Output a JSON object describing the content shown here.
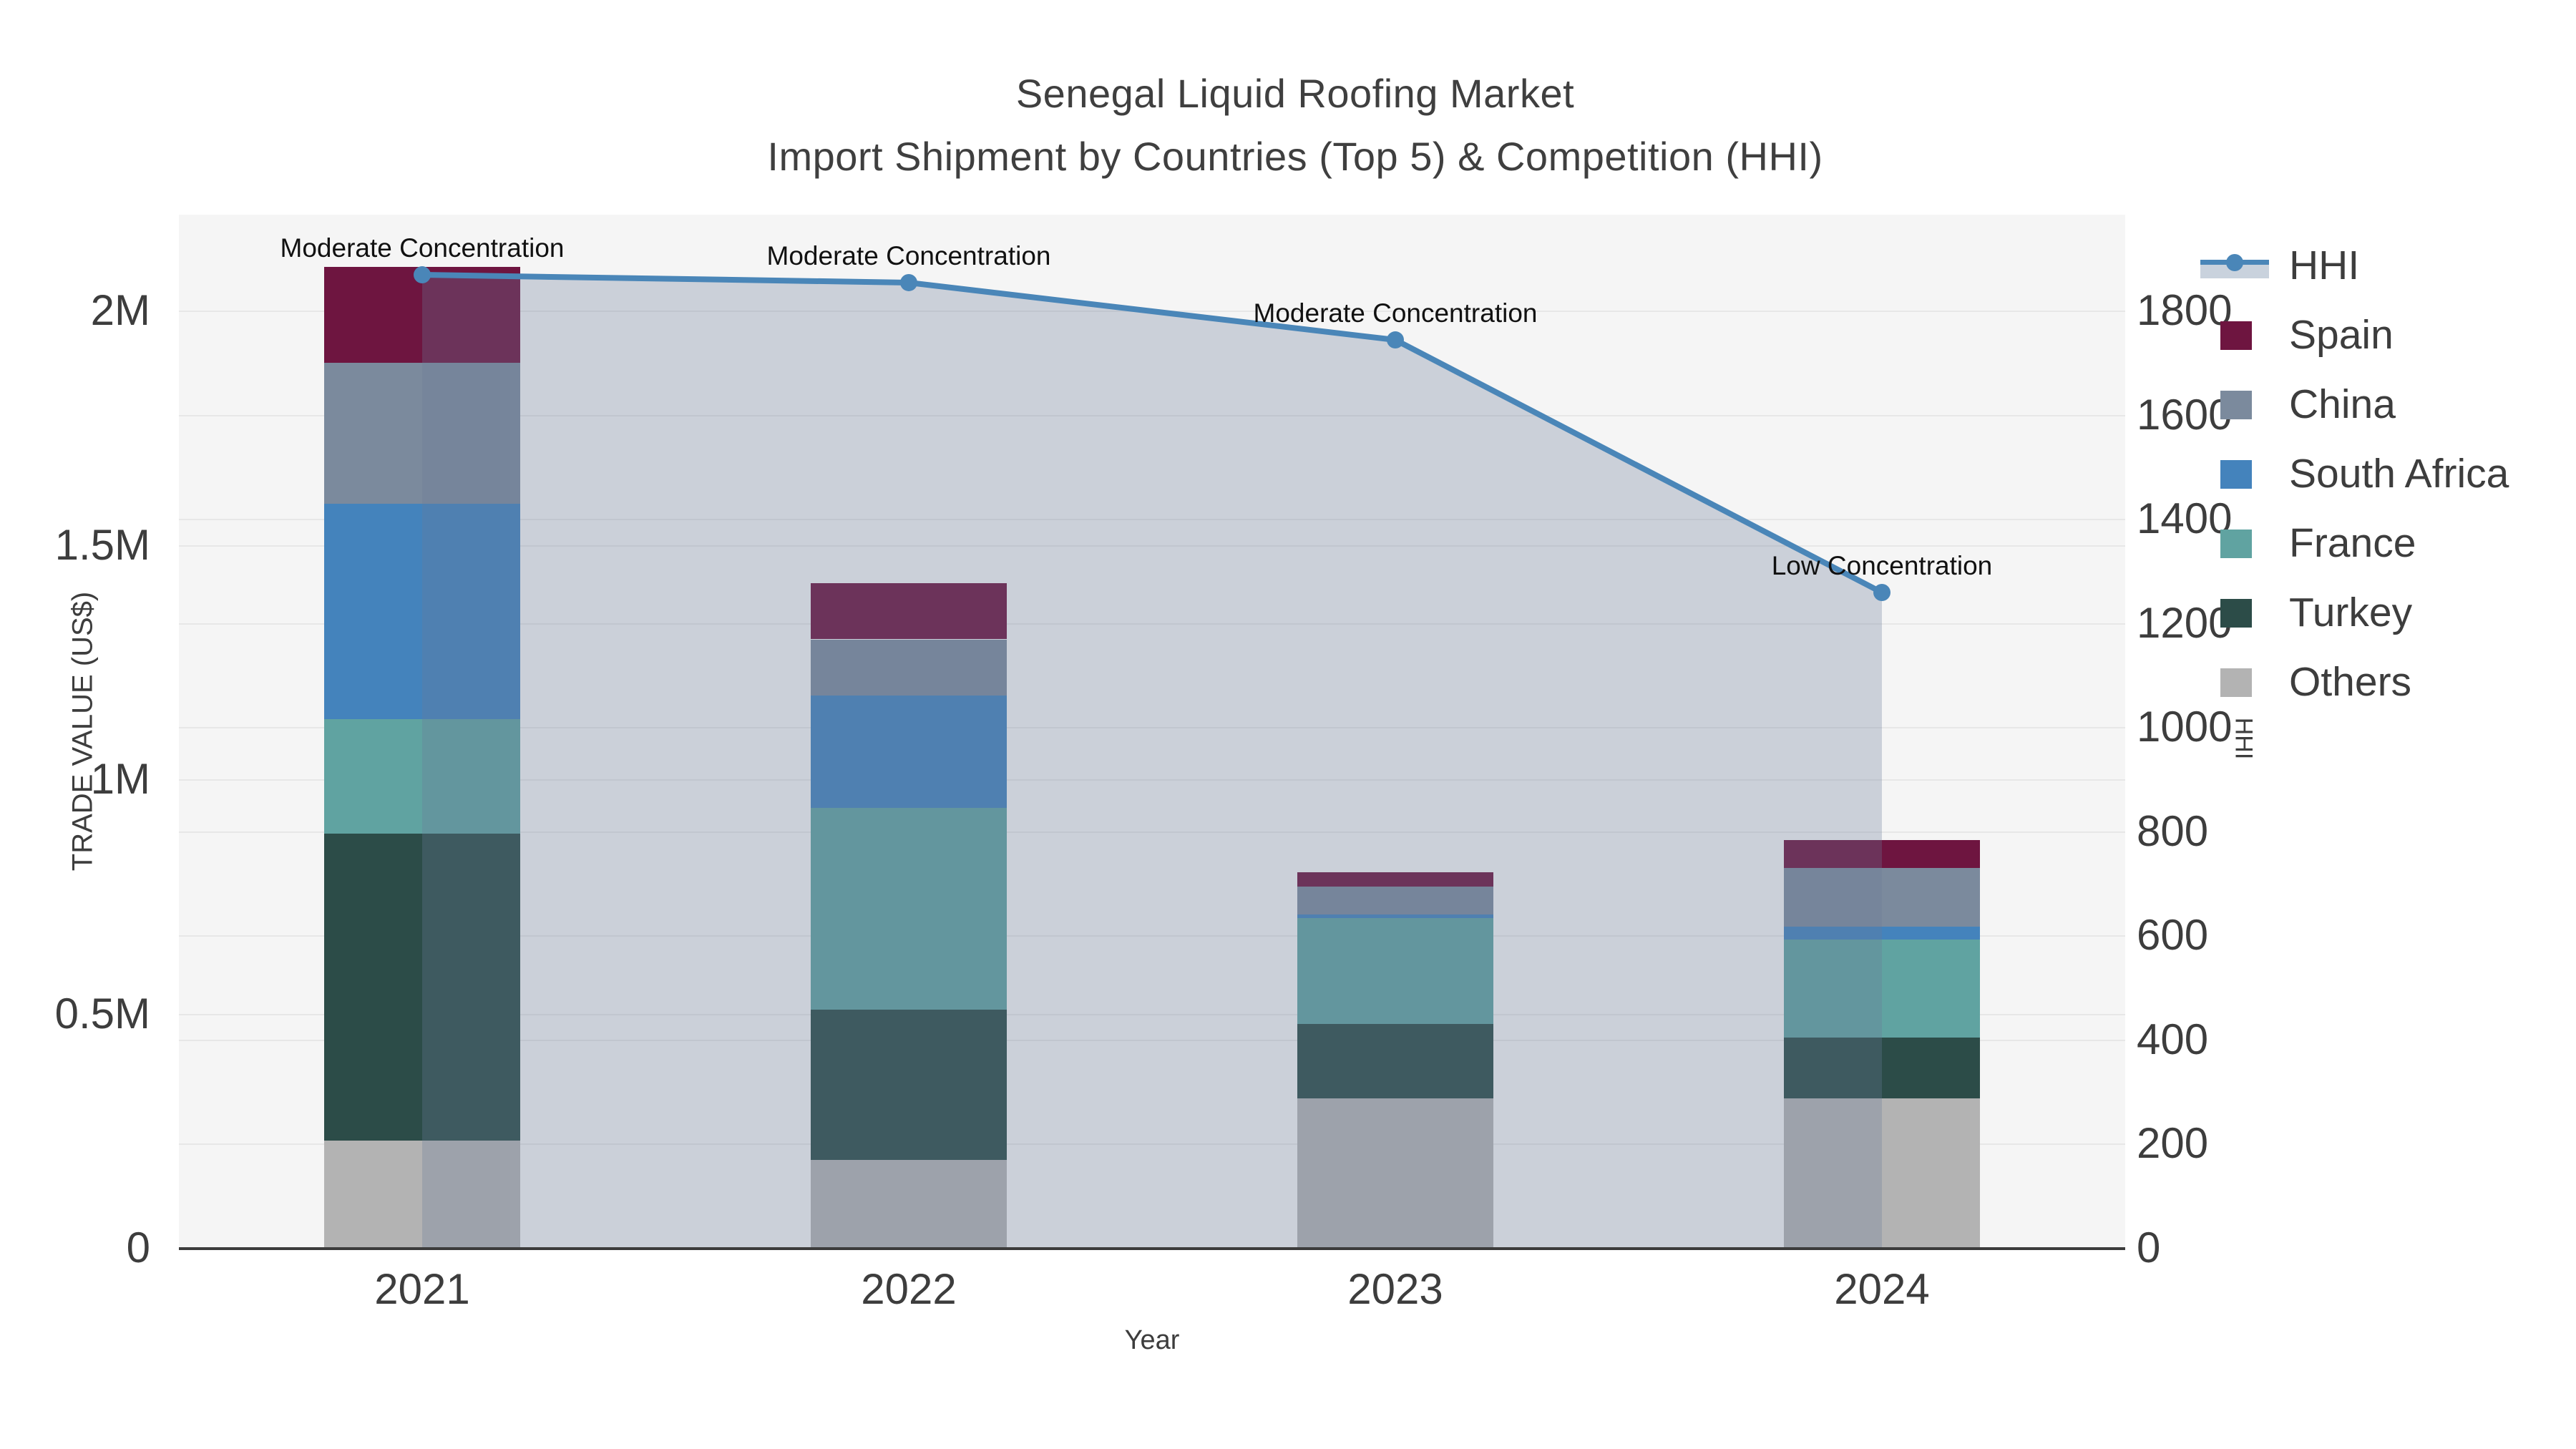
{
  "title": {
    "line1": "Senegal Liquid Roofing Market",
    "line2": "Import Shipment by Countries (Top 5) & Competition (HHI)"
  },
  "axes": {
    "x": {
      "title": "Year",
      "categories": [
        "2021",
        "2022",
        "2023",
        "2024"
      ]
    },
    "y_left": {
      "title": "TRADE VALUE (US$)",
      "ticks": [
        {
          "value": 0,
          "label": "0"
        },
        {
          "value": 500000,
          "label": "0.5M"
        },
        {
          "value": 1000000,
          "label": "1M"
        },
        {
          "value": 1500000,
          "label": "1.5M"
        },
        {
          "value": 2000000,
          "label": "2M"
        }
      ],
      "max_tick_value": 2000000
    },
    "y_right": {
      "title": "HHI",
      "ticks": [
        0,
        200,
        400,
        600,
        800,
        1000,
        1200,
        1400,
        1600,
        1800
      ],
      "max_tick_value": 1800
    }
  },
  "legend": [
    {
      "label": "HHI",
      "type": "line",
      "color": "#4a86b8"
    },
    {
      "label": "Spain",
      "type": "swatch",
      "color": "#6e1540"
    },
    {
      "label": "China",
      "type": "swatch",
      "color": "#7b8a9d"
    },
    {
      "label": "South Africa",
      "type": "swatch",
      "color": "#4483bc"
    },
    {
      "label": "France",
      "type": "swatch",
      "color": "#60a3a1"
    },
    {
      "label": "Turkey",
      "type": "swatch",
      "color": "#2c4c48"
    },
    {
      "label": "Others",
      "type": "swatch",
      "color": "#b3b3b3"
    }
  ],
  "annotations": [
    {
      "category": "2021",
      "text": "Moderate Concentration"
    },
    {
      "category": "2022",
      "text": "Moderate Concentration"
    },
    {
      "category": "2023",
      "text": "Moderate Concentration"
    },
    {
      "category": "2024",
      "text": "Low Concentration"
    }
  ],
  "colors": {
    "hhi_line": "#4a86b8",
    "area_fill": "rgba(106,123,153,0.30)",
    "plot_bg": "#f5f5f5",
    "grid": "#e7e7e7",
    "axis_line": "#3c3c3c",
    "text": "#3d3d3d",
    "annotation_text": "#111111"
  },
  "chart_data": {
    "type": "bar",
    "subtype": "stacked-bars-with-dual-axis-line-area",
    "title": "Senegal Liquid Roofing Market — Import Shipment by Countries (Top 5) & Competition (HHI)",
    "xlabel": "Year",
    "ylabel_left": "TRADE VALUE (US$)",
    "ylabel_right": "HHI",
    "categories": [
      "2021",
      "2022",
      "2023",
      "2024"
    ],
    "series": [
      {
        "name": "Spain",
        "axis": "left",
        "values": [
          205000,
          120000,
          30000,
          60000
        ]
      },
      {
        "name": "China",
        "axis": "left",
        "values": [
          300000,
          120000,
          60000,
          125000
        ]
      },
      {
        "name": "South Africa",
        "axis": "left",
        "values": [
          460000,
          240000,
          8000,
          27000
        ]
      },
      {
        "name": "France",
        "axis": "left",
        "values": [
          245000,
          430000,
          225000,
          210000
        ]
      },
      {
        "name": "Turkey",
        "axis": "left",
        "values": [
          655000,
          320000,
          160000,
          130000
        ]
      },
      {
        "name": "Others",
        "axis": "left",
        "values": [
          230000,
          190000,
          320000,
          320000
        ]
      }
    ],
    "stack_order_bottom_to_top": [
      "Others",
      "Turkey",
      "France",
      "South Africa",
      "China",
      "Spain"
    ],
    "bar_totals_estimated": [
      2095000,
      1420000,
      803000,
      872000
    ],
    "line_series": {
      "name": "HHI",
      "axis": "right",
      "values": [
        1870,
        1855,
        1745,
        1260
      ],
      "area_fill": true
    },
    "ylim_left": [
      0,
      2200000
    ],
    "ylim_right": [
      0,
      1980
    ],
    "grid": true,
    "legend_position": "right"
  }
}
